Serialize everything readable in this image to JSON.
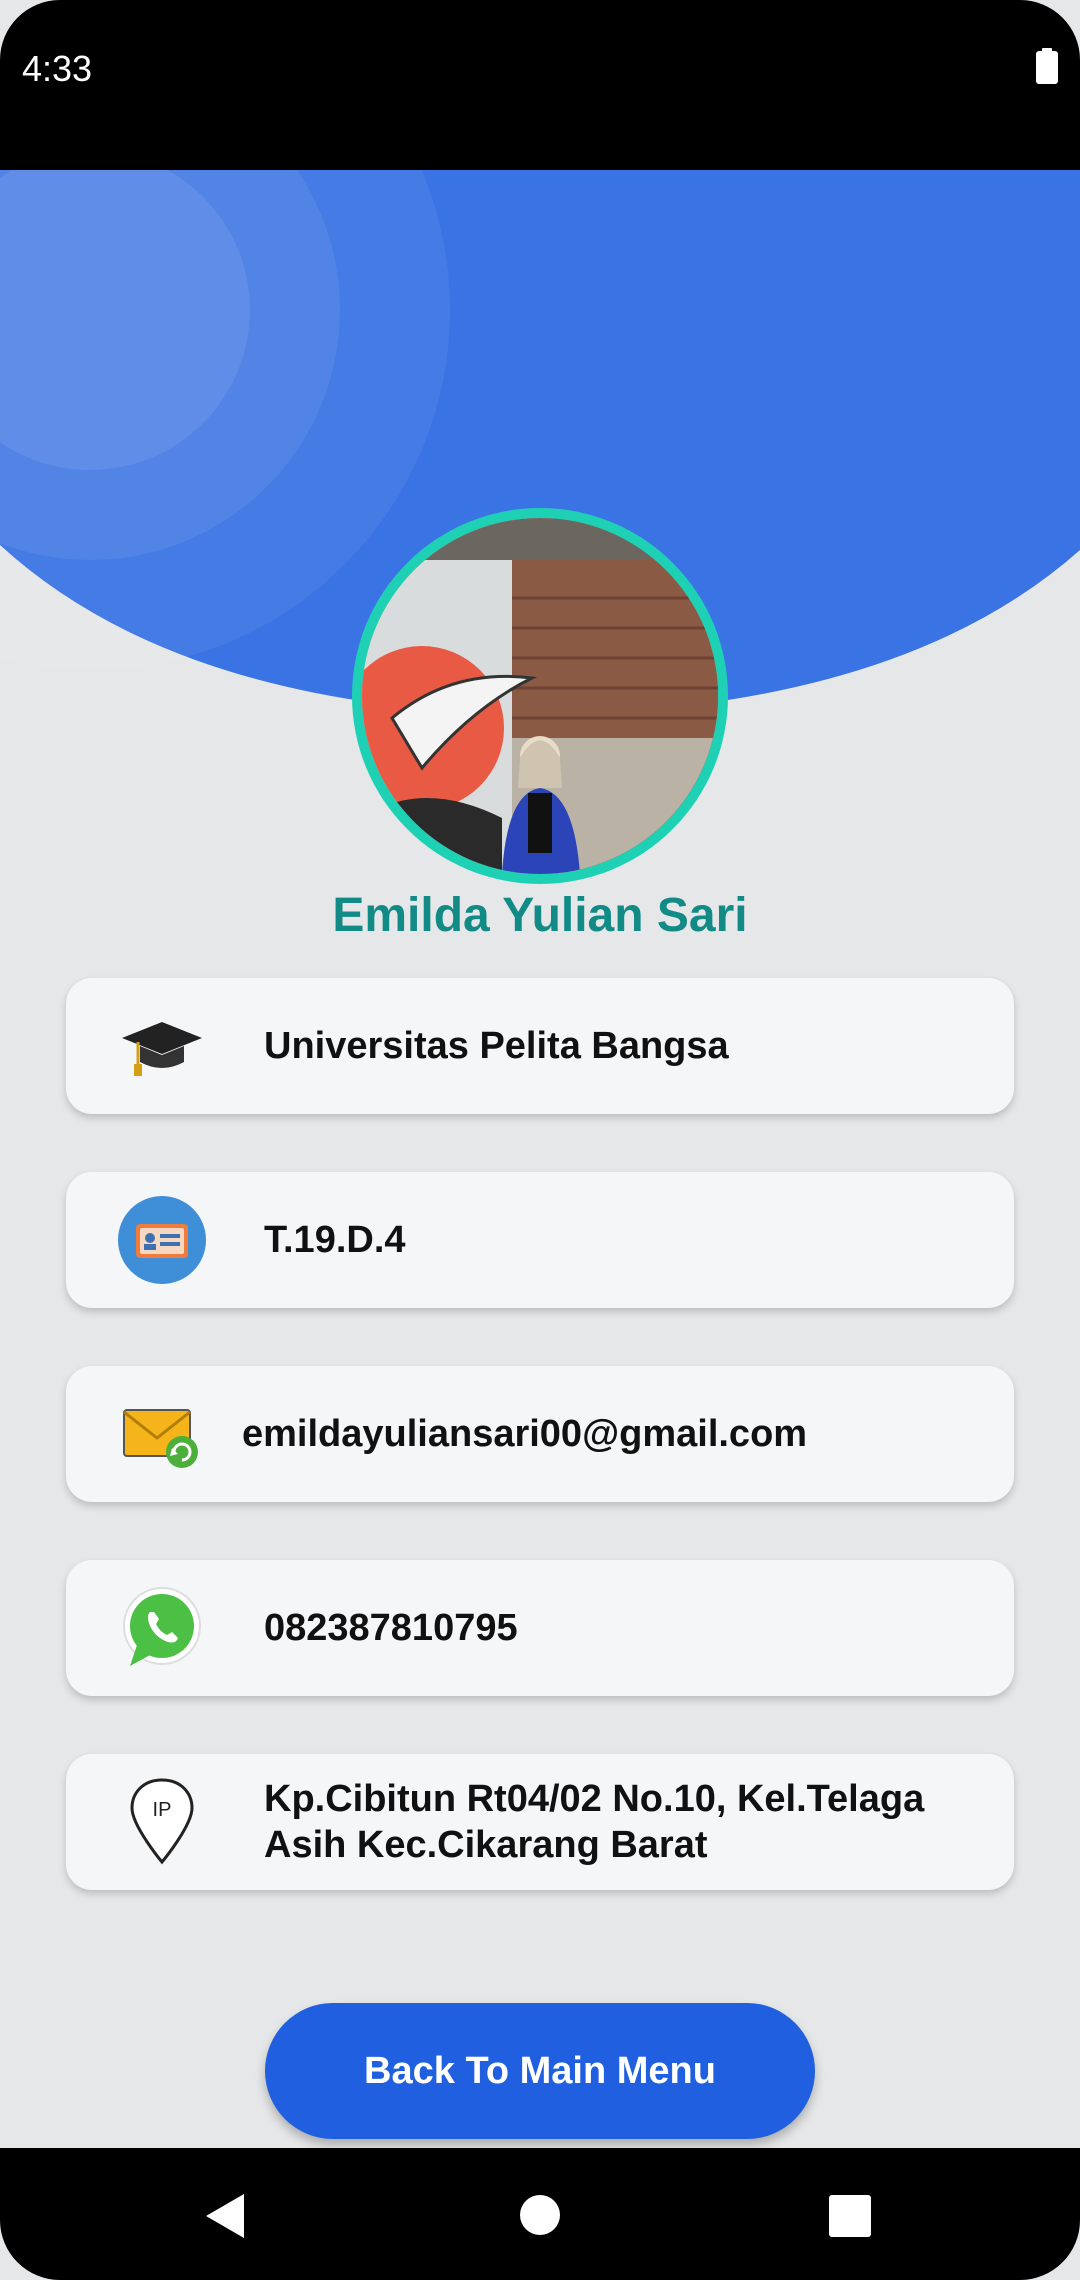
{
  "status_bar": {
    "time": "4:33"
  },
  "profile": {
    "name": "Emilda Yulian Sari"
  },
  "cards": [
    {
      "icon": "graduation-cap-icon",
      "text": "Universitas Pelita Bangsa"
    },
    {
      "icon": "id-card-icon",
      "text": "T.19.D.4"
    },
    {
      "icon": "email-icon",
      "text": "emildayuliansari00@gmail.com"
    },
    {
      "icon": "whatsapp-icon",
      "text": "082387810795"
    },
    {
      "icon": "location-pin-icon",
      "text": "Kp.Cibitun Rt04/02 No.10, Kel.Telaga Asih Kec.Cikarang Barat"
    }
  ],
  "button": {
    "label": "Back To Main Menu"
  },
  "colors": {
    "header_blue": "#3a73e4",
    "accent_teal": "#1fd1b4",
    "name_color": "#128a86",
    "button_blue": "#1f5fe0"
  }
}
